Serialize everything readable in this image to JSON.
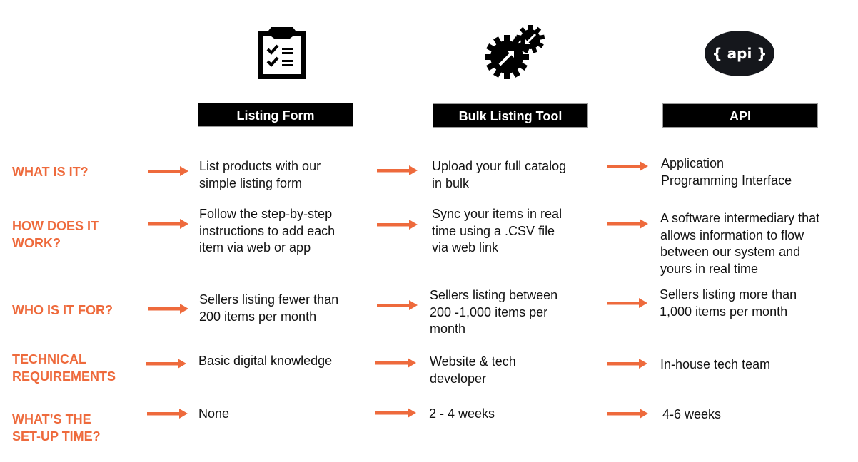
{
  "accent_color": "#EE6A3C",
  "columns": [
    {
      "title": "Listing Form",
      "icon": "clipboard-checklist-icon"
    },
    {
      "title": "Bulk Listing Tool",
      "icon": "gears-sync-icon"
    },
    {
      "title": "API",
      "icon": "api-badge-icon",
      "icon_text": "{ api }"
    }
  ],
  "rows": [
    {
      "label": "WHAT IS IT?",
      "cells": [
        "List products with our\nsimple listing form",
        "Upload your full catalog\nin bulk",
        "Application\nProgramming Interface"
      ]
    },
    {
      "label": "HOW DOES IT\nWORK?",
      "cells": [
        "Follow the step-by-step\ninstructions to add each\nitem via web or app",
        "Sync your items in real\ntime using a .CSV file\nvia web link",
        "A software intermediary that\nallows information to flow\nbetween our system and\nyours in real time"
      ]
    },
    {
      "label": "WHO IS IT FOR?",
      "cells": [
        "Sellers listing fewer than\n200 items per month",
        "Sellers listing between\n200 -1,000 items per\nmonth",
        "Sellers listing more than\n1,000 items per month"
      ]
    },
    {
      "label": "TECHNICAL\nREQUIREMENTS",
      "cells": [
        "Basic digital knowledge",
        "Website & tech\ndeveloper",
        "In-house tech team"
      ]
    },
    {
      "label": "WHAT’S THE\nSET-UP TIME?",
      "cells": [
        "None",
        "2 - 4 weeks",
        "4-6 weeks"
      ]
    }
  ]
}
